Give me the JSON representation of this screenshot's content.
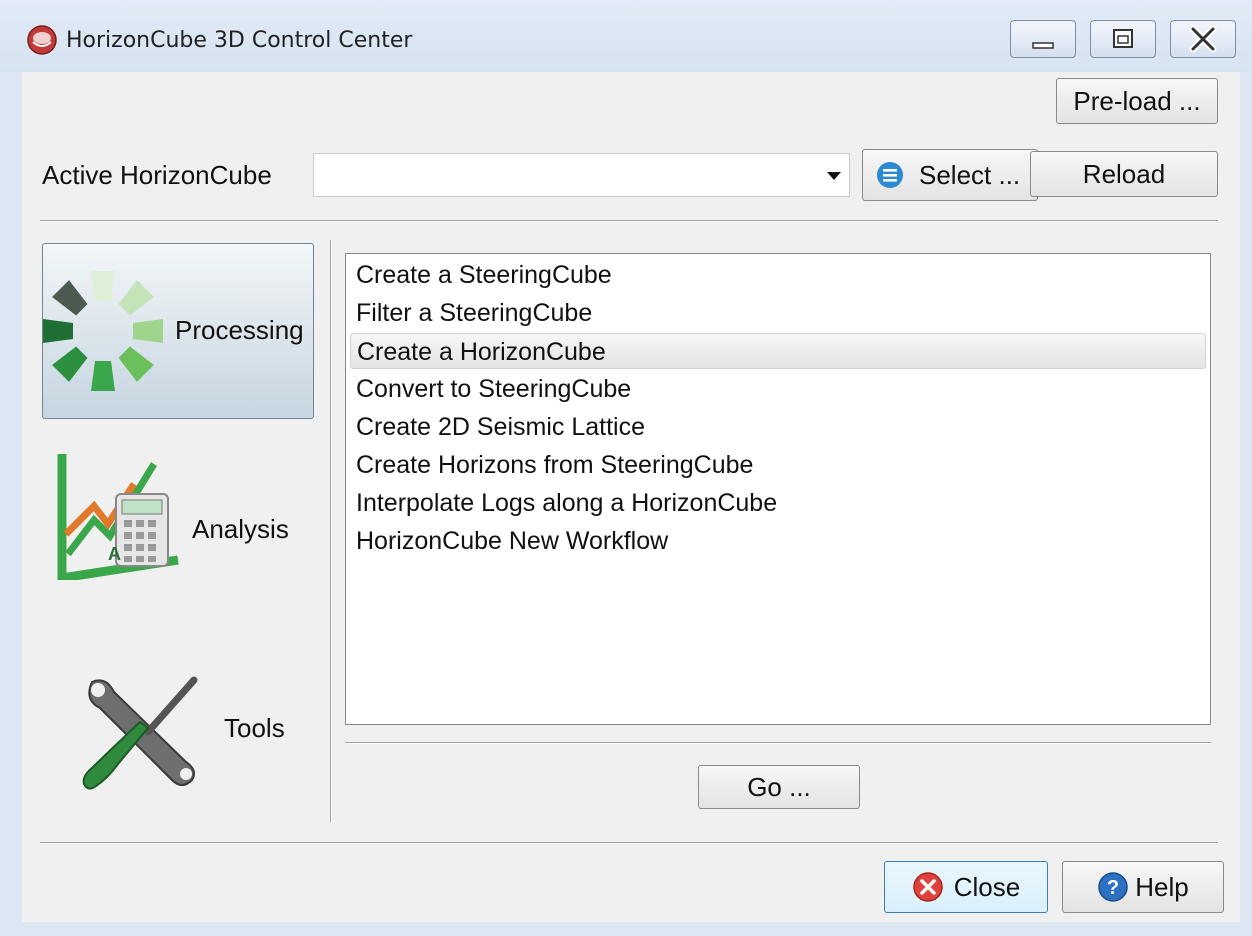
{
  "window": {
    "title": "HorizonCube 3D Control Center"
  },
  "toolbar": {
    "preload_label": "Pre-load ...",
    "active_label": "Active HorizonCube",
    "active_value": "",
    "select_label": "Select ...",
    "reload_label": "Reload"
  },
  "categories": [
    {
      "label": "Processing",
      "icon": "processing-wheel-icon",
      "selected": true
    },
    {
      "label": "Analysis",
      "icon": "analysis-chart-icon",
      "selected": false
    },
    {
      "label": "Tools",
      "icon": "tools-icon",
      "selected": false
    }
  ],
  "workflows": {
    "selected_index": 2,
    "items": [
      "Create a SteeringCube",
      "Filter a SteeringCube",
      "Create a HorizonCube",
      "Convert to SteeringCube",
      "Create 2D Seismic Lattice",
      "Create Horizons from SteeringCube",
      "Interpolate Logs along a HorizonCube",
      "HorizonCube New Workflow"
    ]
  },
  "actions": {
    "go_label": "Go ...",
    "close_label": "Close",
    "help_label": "Help"
  },
  "colors": {
    "titlebar": "#dce7f3",
    "client": "#f0f0f0",
    "accent_green": "#3aa84a",
    "close_red": "#e0413a",
    "help_blue": "#2d6fc0",
    "select_blue": "#2a8ad4"
  }
}
